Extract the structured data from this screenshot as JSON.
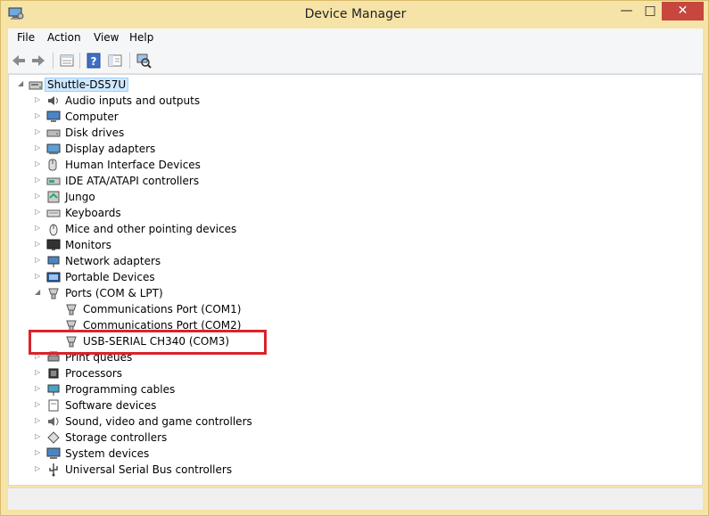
{
  "window": {
    "title": "Device Manager",
    "minimize_glyph": "—",
    "maximize_glyph": "□",
    "close_glyph": "✕"
  },
  "menu": [
    "File",
    "Action",
    "View",
    "Help"
  ],
  "toolbar": [
    "back-icon",
    "forward-icon",
    "properties-view-icon",
    "help-icon",
    "console-tree-icon",
    "scan-hardware-icon"
  ],
  "tree": {
    "root": "Shuttle-DS57U",
    "categories": [
      "Audio inputs and outputs",
      "Computer",
      "Disk drives",
      "Display adapters",
      "Human Interface Devices",
      "IDE ATA/ATAPI controllers",
      "Jungo",
      "Keyboards",
      "Mice and other pointing devices",
      "Monitors",
      "Network adapters",
      "Portable Devices",
      "Ports (COM & LPT)",
      "Print queues",
      "Processors",
      "Programming cables",
      "Software devices",
      "Sound, video and game controllers",
      "Storage controllers",
      "System devices",
      "Universal Serial Bus controllers"
    ],
    "ports_children": [
      "Communications Port (COM1)",
      "Communications Port (COM2)",
      "USB-SERIAL CH340 (COM3)"
    ]
  },
  "colors": {
    "highlight_border": "#d9232b",
    "window_frame": "#f6e3a8",
    "close_button": "#c7463d",
    "selection": "#cde8ff"
  }
}
